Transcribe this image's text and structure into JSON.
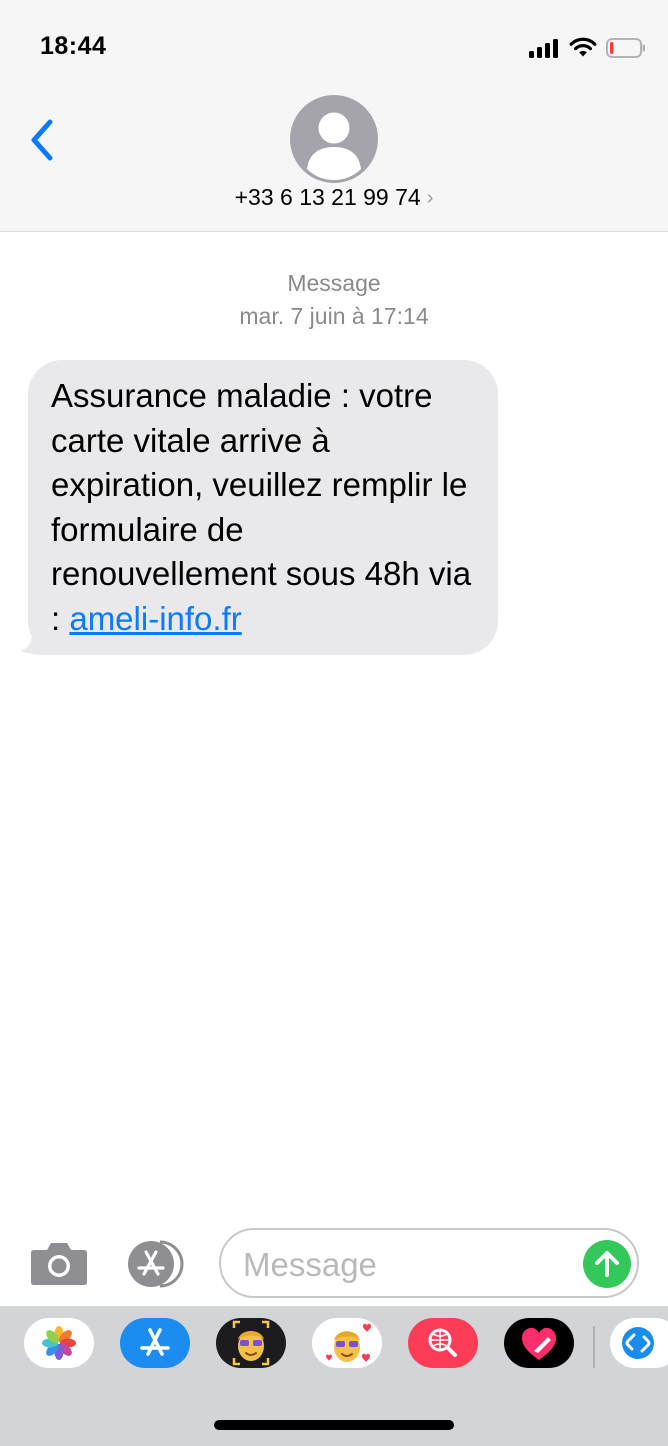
{
  "status_bar": {
    "time": "18:44",
    "signal_icon": "cellular-signal-icon",
    "wifi_icon": "wifi-icon",
    "battery_icon": "battery-low-icon",
    "battery_level": 0.12,
    "battery_color": "#ff3b30"
  },
  "header": {
    "back_icon": "chevron-left-icon",
    "avatar_icon": "person-silhouette-icon",
    "contact": "+33 6 13 21 99 74",
    "contact_chevron": "›"
  },
  "thread": {
    "label": "Message",
    "date": "mar. 7 juin à 17:14",
    "messages": [
      {
        "direction": "incoming",
        "text": "Assurance maladie : votre carte vitale arrive à expiration, veuillez remplir le formulaire de renouvellement sous 48h via : ",
        "link": "ameli-info.fr"
      }
    ]
  },
  "input_bar": {
    "camera_icon": "camera-icon",
    "apps_icon": "app-store-icon",
    "placeholder": "Message",
    "send_icon": "arrow-up-icon"
  },
  "app_drawer": {
    "apps": [
      {
        "name": "photos",
        "icon": "photos-icon"
      },
      {
        "name": "app-store",
        "icon": "app-store-icon"
      },
      {
        "name": "memoji",
        "icon": "memoji-icon"
      },
      {
        "name": "memoji-stickers",
        "icon": "memoji-stickers-icon"
      },
      {
        "name": "web-search",
        "icon": "web-search-icon"
      },
      {
        "name": "digital-touch",
        "icon": "digital-touch-icon"
      },
      {
        "name": "shazam",
        "icon": "shazam-icon"
      }
    ]
  },
  "colors": {
    "accent": "#0a7aff",
    "send": "#34c759",
    "bubble": "#e9e9eb",
    "header_bg": "#f6f6f6",
    "drawer_bg": "#d3d4d8"
  }
}
